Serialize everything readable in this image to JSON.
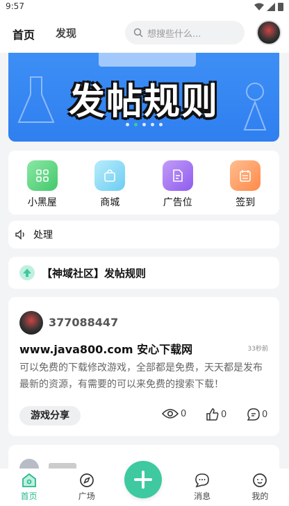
{
  "status_bar": {
    "time": "9:57"
  },
  "header": {
    "tabs": [
      {
        "label": "首页",
        "active": true
      },
      {
        "label": "发现",
        "active": false
      }
    ],
    "search_placeholder": "想搜些什么...",
    "avatar_icon": "user-avatar"
  },
  "banner": {
    "title": "发帖规则",
    "slide_count": 5,
    "active_slide": 2
  },
  "quick_links": [
    {
      "label": "小黑屋",
      "icon": "grid-icon",
      "color": "#5dd37f"
    },
    {
      "label": "商城",
      "icon": "shopping-bag-icon",
      "color": "#7fd8f4"
    },
    {
      "label": "广告位",
      "icon": "document-icon",
      "color": "#a06ff0"
    },
    {
      "label": "签到",
      "icon": "calendar-icon",
      "color": "#ff9a5c"
    }
  ],
  "notice": {
    "text": "处理",
    "icon": "speaker-icon"
  },
  "rules": {
    "text": "【神域社区】发帖规则",
    "icon": "arrow-up-icon"
  },
  "posts": [
    {
      "username": "377088447",
      "title": "www.java800.com 安心下载网",
      "time": "33秒前",
      "body": "可以免费的下载修改游戏，全部都是免费，天天都是发布最新的资源，有需要的可以来免费的搜索下载！",
      "tag": "游戏分享",
      "views": "0",
      "likes": "0",
      "comments": "0"
    }
  ],
  "tabbar": {
    "items": [
      {
        "label": "首页",
        "icon": "home-icon",
        "active": true
      },
      {
        "label": "广场",
        "icon": "compass-icon",
        "active": false
      },
      {
        "label": "消息",
        "icon": "chat-icon",
        "active": false
      },
      {
        "label": "我的",
        "icon": "face-icon",
        "active": false
      }
    ],
    "fab_icon": "plus-icon"
  },
  "colors": {
    "accent": "#3ec9a0",
    "banner": "#3d8ff5"
  }
}
